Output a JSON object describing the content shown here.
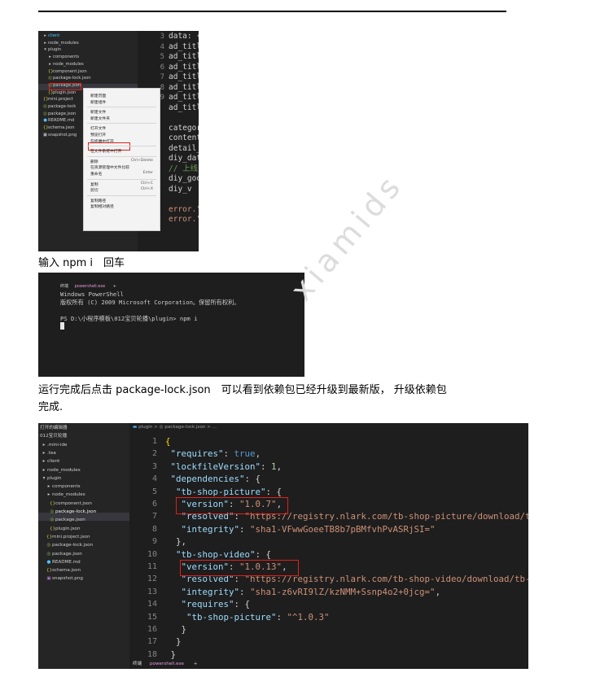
{
  "shot1": {
    "tree": [
      {
        "icon": "▸",
        "label": "client",
        "color": "#4fc1ff"
      },
      {
        "icon": "▸",
        "label": "node_modules",
        "color": "#cfcfcf"
      },
      {
        "icon": "▾",
        "label": "plugin",
        "color": "#cfcfcf"
      },
      {
        "icon": "▸",
        "label": "components",
        "color": "#cfcfcf"
      },
      {
        "icon": "▸",
        "label": "node_modules",
        "color": "#cfcfcf"
      },
      {
        "icon": "{}",
        "label": "component.json",
        "color": "#cfcfcf"
      },
      {
        "icon": "◎",
        "label": "package-lock.json",
        "color": "#cfcfcf"
      },
      {
        "icon": "◎",
        "label": "package.json",
        "color": "#cfcfcf"
      },
      {
        "icon": "{}",
        "label": "plugin.json",
        "color": "#cfcfcf"
      },
      {
        "icon": "{}",
        "label": "mini.project",
        "color": "#cfcfcf"
      },
      {
        "icon": "◎",
        "label": "package-lock",
        "color": "#cfcfcf"
      },
      {
        "icon": "◎",
        "label": "package.json",
        "color": "#cfcfcf"
      },
      {
        "icon": "●",
        "label": "README.md",
        "color": "#cfcfcf"
      },
      {
        "icon": "{}",
        "label": "schema.json",
        "color": "#cfcfcf"
      },
      {
        "icon": "▣",
        "label": "snapshot.png",
        "color": "#cfcfcf"
      }
    ],
    "line_numbers": [
      "3",
      "4",
      "5",
      "6",
      "7",
      "8",
      "9"
    ],
    "code_lines": [
      {
        "text": "data: {",
        "cls": ""
      },
      {
        "text": "  ad_titl",
        "cls": ""
      },
      {
        "text": "  ad_titl",
        "cls": ""
      },
      {
        "text": "  ad_titl",
        "cls": ""
      },
      {
        "text": "  ad_titl",
        "cls": ""
      },
      {
        "text": "  ad_titl",
        "cls": ""
      },
      {
        "text": "  ad_titl",
        "cls": ""
      },
      {
        "text": "  ad_titl",
        "cls": ""
      },
      {
        "text": "",
        "cls": ""
      },
      {
        "text": "  categor",
        "cls": ""
      },
      {
        "text": "  content",
        "cls": ""
      },
      {
        "text": "  detail_",
        "cls": ""
      },
      {
        "text": "  diy_dat",
        "cls": ""
      },
      {
        "text": "  // 上线",
        "cls": "g"
      },
      {
        "text": "  diy_goo",
        "cls": ""
      },
      {
        "text": "    diy_v",
        "cls": ""
      },
      {
        "text": "",
        "cls": ""
      },
      {
        "text": "error.\"",
        "cls": "s"
      },
      {
        "text": "error.\"",
        "cls": "s"
      }
    ],
    "context_menu": [
      {
        "label": "新建页面",
        "key": ""
      },
      {
        "label": "新建组件",
        "key": ""
      },
      {
        "sep": true
      },
      {
        "label": "新建文件",
        "key": ""
      },
      {
        "label": "新建文件夹",
        "key": ""
      },
      {
        "sep": true
      },
      {
        "label": "打开文件",
        "key": ""
      },
      {
        "label": "预览打开",
        "key": ""
      },
      {
        "label": "在终端中打开",
        "key": ""
      },
      {
        "sep": true
      },
      {
        "label": "在文件系统中打开",
        "key": ""
      },
      {
        "sep": true
      },
      {
        "label": "删除",
        "key": "Ctrl+Delete"
      },
      {
        "label": "在资源管理中文件比较",
        "key": ""
      },
      {
        "label": "重命名",
        "key": "Enter"
      },
      {
        "sep": true
      },
      {
        "label": "复制",
        "key": "Ctrl+C"
      },
      {
        "label": "剪切",
        "key": "Ctrl+X"
      },
      {
        "sep": true
      },
      {
        "label": "复制路径",
        "key": ""
      },
      {
        "label": "复制相对路径",
        "key": ""
      }
    ]
  },
  "caption1": "输入 npm i　回车",
  "shot2": {
    "tab_label": "终端",
    "tab_name": "powershell.exe",
    "tab_plus": "+",
    "lines": [
      "Windows PowerShell",
      "版权所有 (C) 2009 Microsoft Corporation。保留所有权利。",
      "",
      "PS D:\\小程序模板\\012宝贝轮播\\plugin> npm i"
    ]
  },
  "caption2_line1": "运行完成后点击 package-lock.json　可以看到依赖包已经升级到最新版， 升级依赖包",
  "caption2_line2": "完成.",
  "shot3": {
    "tree": [
      {
        "icon": "",
        "label": "打开的编辑器"
      },
      {
        "icon": "",
        "label": "012宝贝轮播"
      },
      {
        "icon": "▸",
        "label": ".mini-ide"
      },
      {
        "icon": "▸",
        "label": ".tea"
      },
      {
        "icon": "▸",
        "label": "client"
      },
      {
        "icon": "▸",
        "label": "node_modules"
      },
      {
        "icon": "▾",
        "label": "plugin"
      },
      {
        "icon": "▸",
        "label": "components"
      },
      {
        "icon": "▸",
        "label": "node_modules"
      },
      {
        "icon": "{}",
        "label": "component.json"
      },
      {
        "icon": "◎",
        "label": "package-lock.json"
      },
      {
        "icon": "◎",
        "label": "package.json"
      },
      {
        "icon": "{}",
        "label": "plugin.json"
      },
      {
        "icon": "{}",
        "label": "mini.project.json"
      },
      {
        "icon": "◎",
        "label": "package-lock.json"
      },
      {
        "icon": "◎",
        "label": "package.json"
      },
      {
        "icon": "●",
        "label": "README.md"
      },
      {
        "icon": "{}",
        "label": "schema.json"
      },
      {
        "icon": "▣",
        "label": "snapshot.png"
      }
    ],
    "breadcrumb": "plugin > ◎ package-lock.json > ...",
    "line_numbers": [
      "1",
      "2",
      "3",
      "4",
      "5",
      "6",
      "7",
      "8",
      "9",
      "10",
      "11",
      "12",
      "13",
      "14",
      "15",
      "16",
      "17",
      "18"
    ],
    "code": [
      [
        {
          "t": "{",
          "c": "br"
        }
      ],
      [
        {
          "t": " ",
          "c": ""
        },
        {
          "t": "\"requires\"",
          "c": "k"
        },
        {
          "t": ": ",
          "c": ""
        },
        {
          "t": "true",
          "c": "kw"
        },
        {
          "t": ",",
          "c": ""
        }
      ],
      [
        {
          "t": " ",
          "c": ""
        },
        {
          "t": "\"lockfileVersion\"",
          "c": "k"
        },
        {
          "t": ": ",
          "c": ""
        },
        {
          "t": "1",
          "c": "nm"
        },
        {
          "t": ",",
          "c": ""
        }
      ],
      [
        {
          "t": " ",
          "c": ""
        },
        {
          "t": "\"dependencies\"",
          "c": "k"
        },
        {
          "t": ": {",
          "c": ""
        }
      ],
      [
        {
          "t": "  ",
          "c": ""
        },
        {
          "t": "\"tb-shop-picture\"",
          "c": "k"
        },
        {
          "t": ": {",
          "c": ""
        }
      ],
      [
        {
          "t": "   ",
          "c": ""
        },
        {
          "t": "\"version\"",
          "c": "k"
        },
        {
          "t": ": ",
          "c": ""
        },
        {
          "t": "\"1.0.7\"",
          "c": "st"
        },
        {
          "t": ",",
          "c": ""
        }
      ],
      [
        {
          "t": "   ",
          "c": ""
        },
        {
          "t": "\"resolved\"",
          "c": "k"
        },
        {
          "t": ": ",
          "c": ""
        },
        {
          "t": "\"https://registry.nlark.com/tb-shop-picture/download/tb",
          "c": "st"
        }
      ],
      [
        {
          "t": "   ",
          "c": ""
        },
        {
          "t": "\"integrity\"",
          "c": "k"
        },
        {
          "t": ": ",
          "c": ""
        },
        {
          "t": "\"sha1-VFwwGoeeTB8b7pBMfvhPvASRjSI=\"",
          "c": "st"
        }
      ],
      [
        {
          "t": "  },",
          "c": ""
        }
      ],
      [
        {
          "t": "  ",
          "c": ""
        },
        {
          "t": "\"tb-shop-video\"",
          "c": "k"
        },
        {
          "t": ": {",
          "c": ""
        }
      ],
      [
        {
          "t": "   ",
          "c": ""
        },
        {
          "t": "\"version\"",
          "c": "k"
        },
        {
          "t": ": ",
          "c": ""
        },
        {
          "t": "\"1.0.13\"",
          "c": "st"
        },
        {
          "t": ",",
          "c": ""
        }
      ],
      [
        {
          "t": "   ",
          "c": ""
        },
        {
          "t": "\"resolved\"",
          "c": "k"
        },
        {
          "t": ": ",
          "c": ""
        },
        {
          "t": "\"https://registry.nlark.com/tb-shop-video/download/tb-s",
          "c": "st"
        }
      ],
      [
        {
          "t": "   ",
          "c": ""
        },
        {
          "t": "\"integrity\"",
          "c": "k"
        },
        {
          "t": ": ",
          "c": ""
        },
        {
          "t": "\"sha1-z6vRI9lZ/kzNMM+Ssnp4o2+0jcg=\"",
          "c": "st"
        },
        {
          "t": ",",
          "c": ""
        }
      ],
      [
        {
          "t": "   ",
          "c": ""
        },
        {
          "t": "\"requires\"",
          "c": "k"
        },
        {
          "t": ": {",
          "c": ""
        }
      ],
      [
        {
          "t": "    ",
          "c": ""
        },
        {
          "t": "\"tb-shop-picture\"",
          "c": "k"
        },
        {
          "t": ": ",
          "c": ""
        },
        {
          "t": "\"^1.0.3\"",
          "c": "st"
        }
      ],
      [
        {
          "t": "   }",
          "c": ""
        }
      ],
      [
        {
          "t": "  }",
          "c": ""
        }
      ],
      [
        {
          "t": " }",
          "c": ""
        }
      ]
    ],
    "tab_label": "终端",
    "tab_name": "powershell.exe",
    "tab_plus": "+"
  },
  "watermark": "xiamids",
  "colors": {
    "highlight_red": "#e0201a",
    "terminal_tab": "#e39ad8"
  }
}
